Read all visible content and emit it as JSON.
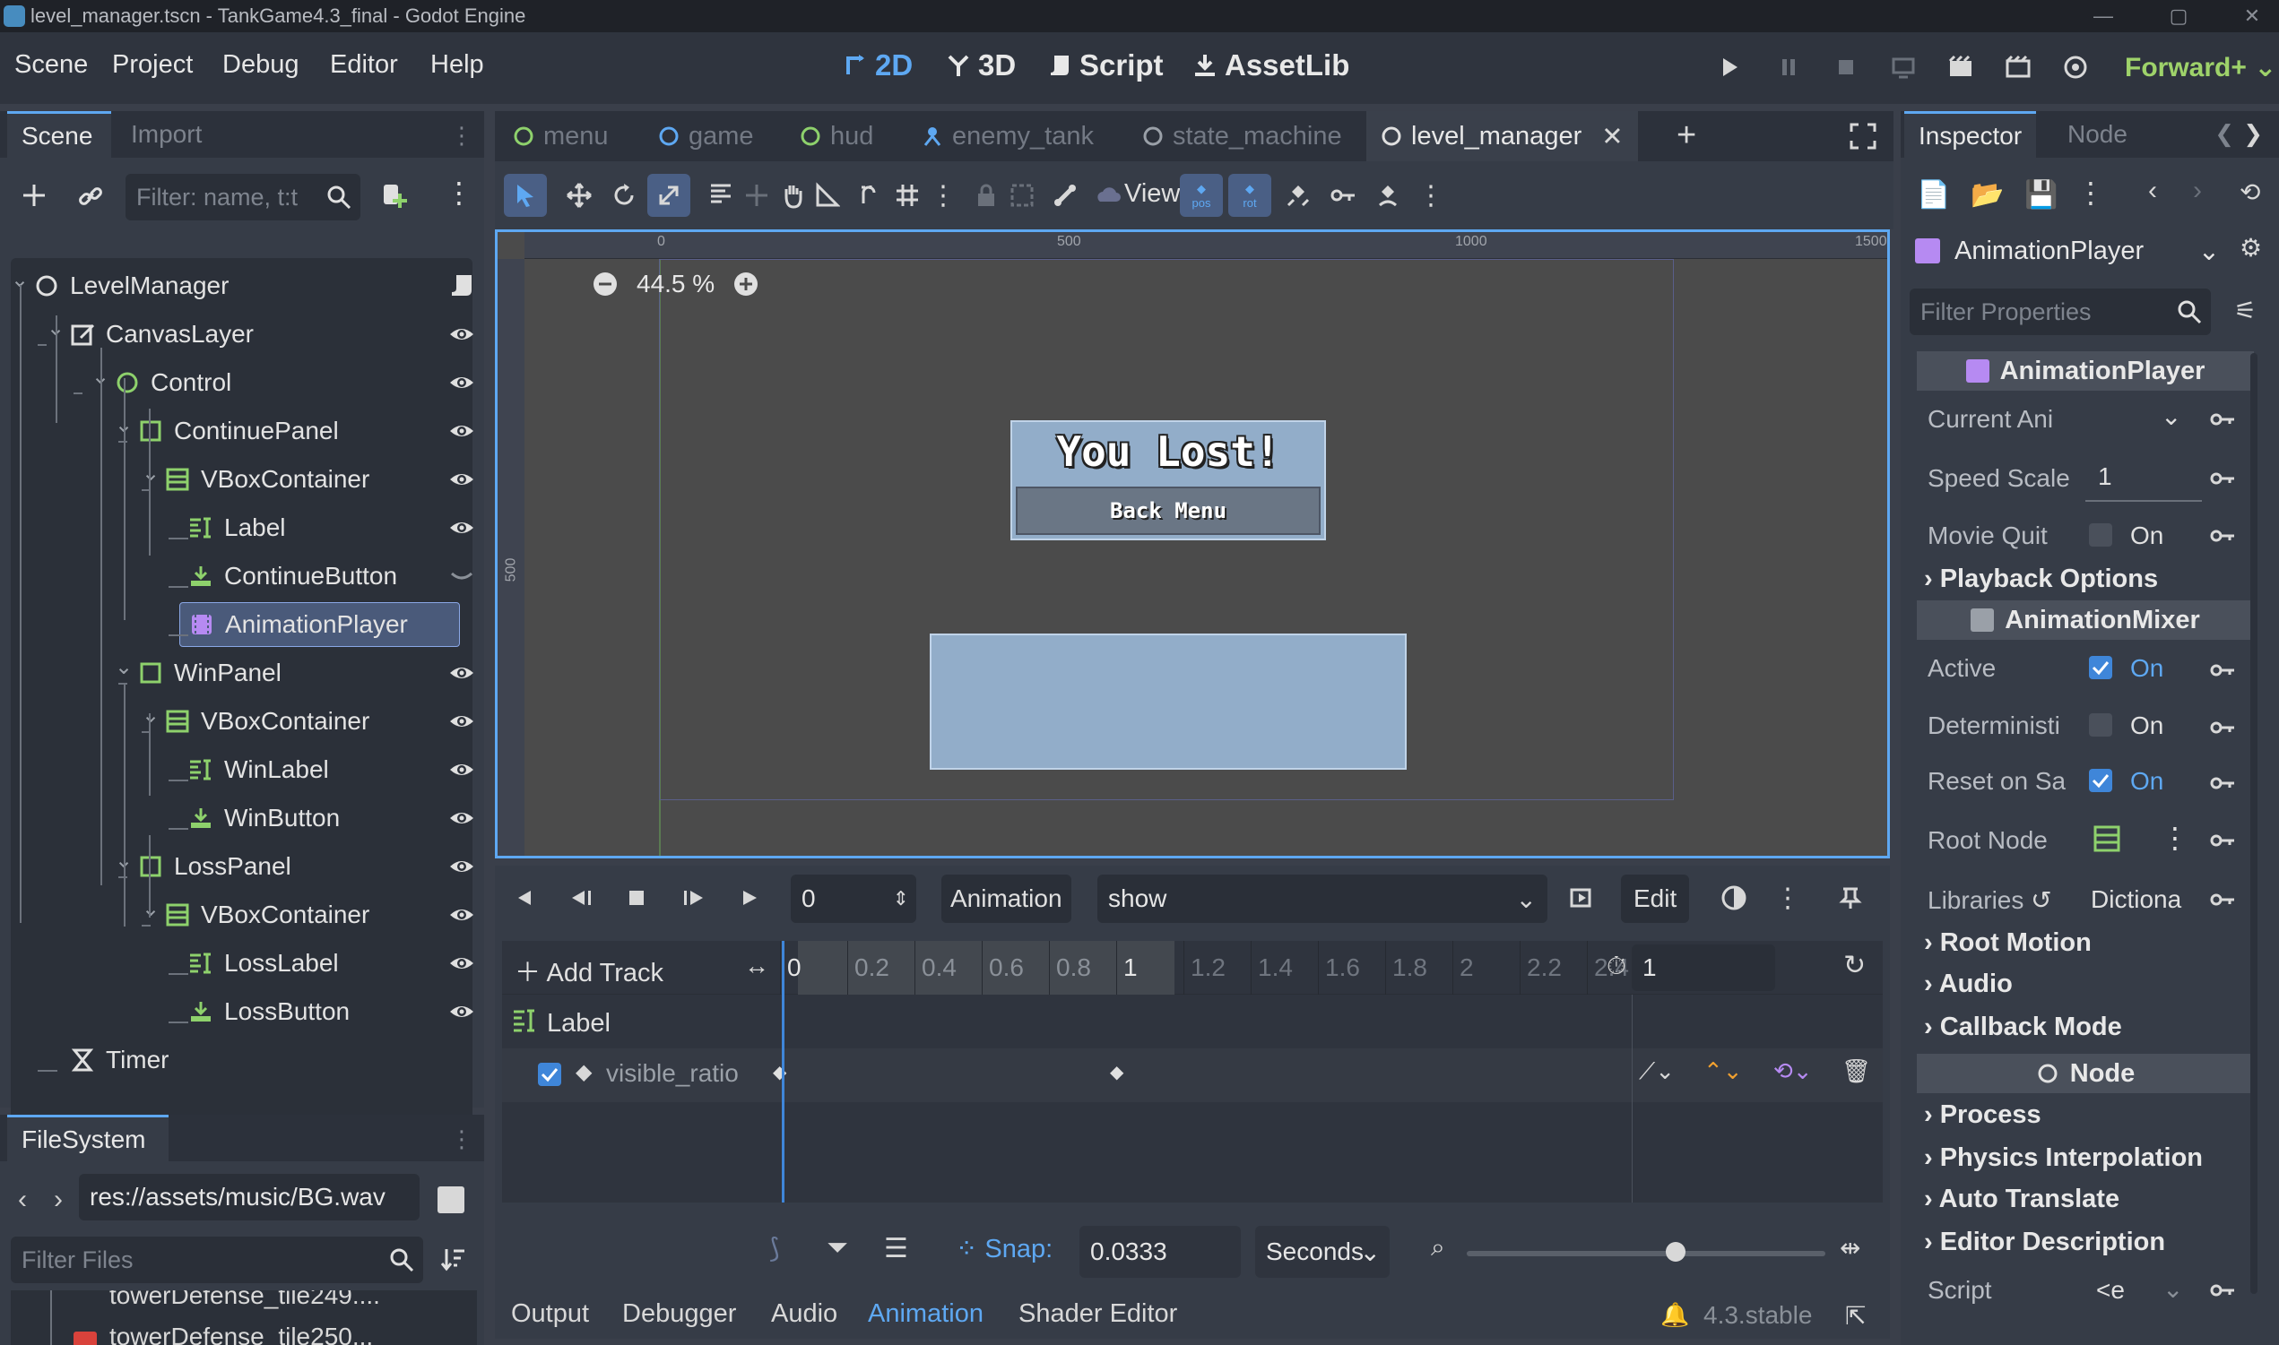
{
  "window": {
    "title": "level_manager.tscn - TankGame4.3_final - Godot Engine",
    "controls": [
      "—",
      "▢",
      "✕"
    ]
  },
  "menubar": {
    "menus": [
      "Scene",
      "Project",
      "Debug",
      "Editor",
      "Help"
    ],
    "workspaces": [
      {
        "label": "2D",
        "active": true
      },
      {
        "label": "3D"
      },
      {
        "label": "Script"
      },
      {
        "label": "AssetLib"
      }
    ],
    "renderer": "Forward+"
  },
  "scene_dock": {
    "tabs": [
      "Scene",
      "Import"
    ],
    "filter_placeholder": "Filter: name, t:t",
    "tree": [
      {
        "label": "LevelManager",
        "icon": "node-icon",
        "depth": 0
      },
      {
        "label": "CanvasLayer",
        "icon": "canvaslayer-icon",
        "depth": 1
      },
      {
        "label": "Control",
        "icon": "control-icon",
        "depth": 2
      },
      {
        "label": "ContinuePanel",
        "icon": "panel-icon",
        "depth": 3
      },
      {
        "label": "VBoxContainer",
        "icon": "vbox-icon",
        "depth": 4
      },
      {
        "label": "Label",
        "icon": "label-icon",
        "depth": 5
      },
      {
        "label": "ContinueButton",
        "icon": "button-icon",
        "depth": 5
      },
      {
        "label": "AnimationPlayer",
        "icon": "animationplayer-icon",
        "depth": 5,
        "selected": true
      },
      {
        "label": "WinPanel",
        "icon": "panel-icon",
        "depth": 3
      },
      {
        "label": "VBoxContainer",
        "icon": "vbox-icon",
        "depth": 4
      },
      {
        "label": "WinLabel",
        "icon": "label-icon",
        "depth": 5
      },
      {
        "label": "WinButton",
        "icon": "button-icon",
        "depth": 5
      },
      {
        "label": "LossPanel",
        "icon": "panel-icon",
        "depth": 3
      },
      {
        "label": "VBoxContainer",
        "icon": "vbox-icon",
        "depth": 4
      },
      {
        "label": "LossLabel",
        "icon": "label-icon",
        "depth": 5
      },
      {
        "label": "LossButton",
        "icon": "button-icon",
        "depth": 5
      },
      {
        "label": "Timer",
        "icon": "timer-icon",
        "depth": 1
      }
    ]
  },
  "filesystem": {
    "tab": "FileSystem",
    "path": "res://assets/music/BG.wav",
    "filter_placeholder": "Filter Files",
    "files": [
      "towerDefense_tile249....",
      "towerDefense_tile250..."
    ]
  },
  "scene_tabs": [
    {
      "label": "menu"
    },
    {
      "label": "game"
    },
    {
      "label": "hud"
    },
    {
      "label": "enemy_tank"
    },
    {
      "label": "state_machine"
    },
    {
      "label": "level_manager",
      "active": true
    }
  ],
  "toolbar": {
    "view_label": "View",
    "pos_label": "pos",
    "rot_label": "rot"
  },
  "viewport": {
    "zoom": "44.5 %",
    "ruler_h_labels": [
      "0",
      "500",
      "1000",
      "1500"
    ],
    "ruler_v_labels": [
      "500"
    ],
    "card_title": "You Lost!",
    "card_button": "Back Menu"
  },
  "animation": {
    "time_value": "0",
    "animation_label": "Animation",
    "animation_selected": "show",
    "edit_label": "Edit",
    "add_track": "Add Track",
    "ticks": [
      "0",
      "0.2",
      "0.4",
      "0.6",
      "0.8",
      "1",
      "1.2",
      "1.4",
      "1.6",
      "1.8",
      "2",
      "2.2",
      "2.4"
    ],
    "length": "1",
    "track_node": "Label",
    "track_property": "visible_ratio",
    "snap_label": "Snap:",
    "snap_value": "0.0333",
    "snap_unit": "Seconds"
  },
  "bottom_panel": {
    "tabs": [
      "Output",
      "Debugger",
      "Audio",
      "Animation",
      "Shader Editor"
    ],
    "active": "Animation",
    "version": "4.3.stable"
  },
  "inspector": {
    "tabs": [
      "Inspector",
      "Node"
    ],
    "object": "AnimationPlayer",
    "filter_placeholder": "Filter Properties",
    "section_animplayer": "AnimationPlayer",
    "current_anim": "Current Ani",
    "speed_scale": {
      "label": "Speed Scale",
      "value": "1"
    },
    "movie_quit": {
      "label": "Movie Quit",
      "value": "On"
    },
    "playback_options": "Playback Options",
    "section_mixer": "AnimationMixer",
    "active": {
      "label": "Active",
      "value": "On"
    },
    "deterministic": {
      "label": "Deterministi",
      "value": "On"
    },
    "reset_on_save": {
      "label": "Reset on Sa",
      "value": "On"
    },
    "root_node": "Root Node",
    "libraries": {
      "label": "Libraries",
      "value": "Dictiona"
    },
    "groups": [
      "Root Motion",
      "Audio",
      "Callback Mode"
    ],
    "section_node": "Node",
    "node_groups": [
      "Process",
      "Physics Interpolation",
      "Auto Translate",
      "Editor Description"
    ],
    "script": {
      "label": "Script",
      "value": "<e"
    }
  },
  "colors": {
    "accent": "#5ea8f2",
    "panel": "#363c47",
    "node_green": "#8ed16c",
    "anim_purple": "#b68af2"
  }
}
